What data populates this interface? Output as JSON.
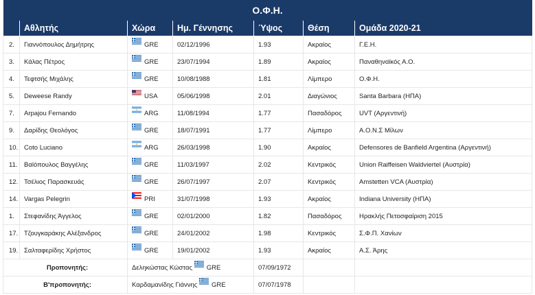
{
  "title": "Ο.Φ.Η.",
  "headers": [
    "",
    "Αθλητής",
    "Χώρα",
    "Ημ. Γέννησης",
    "Ύψος",
    "Θέση",
    "Ομάδα 2020-21"
  ],
  "players": [
    {
      "num": "2.",
      "name": "Γιαννόπουλος Δημήτρης",
      "flag": "gr-flag-icon",
      "country": "GRE",
      "dob": "02/12/1996",
      "height": "1.93",
      "position": "Ακραίος",
      "team": "Γ.Ε.Η."
    },
    {
      "num": "3.",
      "name": "Κάλας Πέτρος",
      "flag": "gr-flag-icon",
      "country": "GRE",
      "dob": "23/07/1994",
      "height": "1.89",
      "position": "Ακραίος",
      "team": "Παναθηναϊκός Α.Ο."
    },
    {
      "num": "4.",
      "name": "Τεφτσής Μιχάλης",
      "flag": "gr-flag-icon",
      "country": "GRE",
      "dob": "10/08/1988",
      "height": "1.81",
      "position": "Λίμπερο",
      "team": "Ο.Φ.Η."
    },
    {
      "num": "5.",
      "name": "Deweese Randy",
      "flag": "us-flag-icon",
      "country": "USA",
      "dob": "05/06/1998",
      "height": "2.01",
      "position": "Διαγώνιος",
      "team": "Santa Barbara (ΗΠΑ)"
    },
    {
      "num": "7.",
      "name": "Arpajou Fernando",
      "flag": "ar-flag-icon",
      "country": "ARG",
      "dob": "11/08/1994",
      "height": "1.77",
      "position": "Πασαδόρος",
      "team": "UVT (Αργεντινή)"
    },
    {
      "num": "9.",
      "name": "Δαρίδης Θεολόγος",
      "flag": "gr-flag-icon",
      "country": "GRE",
      "dob": "18/07/1991",
      "height": "1.77",
      "position": "Λίμπερο",
      "team": "Α.Ο.Ν.Σ Μίλων"
    },
    {
      "num": "10.",
      "name": "Coto Luciano",
      "flag": "ar-flag-icon",
      "country": "ARG",
      "dob": "26/03/1998",
      "height": "1.90",
      "position": "Ακραίος",
      "team": "Defensores de Banfield Argentina (Αργεντινή)"
    },
    {
      "num": "11.",
      "name": "Βαϊόπουλος Βαγγέλης",
      "flag": "gr-flag-icon",
      "country": "GRE",
      "dob": "11/03/1997",
      "height": "2.02",
      "position": "Κεντρικός",
      "team": "Union Raiffeisen Waldviertel (Αυστρία)"
    },
    {
      "num": "12.",
      "name": "Τσέλιος Παρασκευάς",
      "flag": "gr-flag-icon",
      "country": "GRE",
      "dob": "26/07/1997",
      "height": "2.07",
      "position": "Κεντρικός",
      "team": "Amstetten VCA (Αυστρία)"
    },
    {
      "num": "14.",
      "name": "Vargas Pelegrin",
      "flag": "pr-flag-icon",
      "country": "PRI",
      "dob": "31/07/1998",
      "height": "1.93",
      "position": "Ακραίος",
      "team": "Indiana University (ΗΠΑ)"
    },
    {
      "num": "1.",
      "name": "Στεφανίδης Άγγελος",
      "flag": "gr-flag-icon",
      "country": "GRE",
      "dob": "02/01/2000",
      "height": "1.82",
      "position": "Πασαδόρος",
      "team": "Ηρακλής Πετοσφαίριση 2015"
    },
    {
      "num": "17.",
      "name": "Τζουγκαράκης Αλέξανδρος",
      "flag": "gr-flag-icon",
      "country": "GRE",
      "dob": "24/01/2002",
      "height": "1.98",
      "position": "Κεντρικός",
      "team": "Σ.Φ.Π. Χανίων"
    },
    {
      "num": "19.",
      "name": "Σαλταφερίδης Χρήστος",
      "flag": "gr-flag-icon",
      "country": "GRE",
      "dob": "19/01/2002",
      "height": "1.93",
      "position": "Ακραίος",
      "team": "Α.Σ. Άρης"
    }
  ],
  "staff": [
    {
      "label": "Προπονητής:",
      "name": "Δεληκώστας Κώστας",
      "flag": "gr-flag-icon",
      "country": "GRE",
      "dob": "07/09/1972"
    },
    {
      "label": "Β'προπονητής:",
      "name": "Καρδαμανίδης Γιάννης",
      "flag": "gr-flag-icon",
      "country": "GRE",
      "dob": "07/07/1978"
    }
  ],
  "colors": {
    "header_bg": "#1a3a68",
    "header_text": "#ffffff",
    "border": "#e6e6e6"
  }
}
